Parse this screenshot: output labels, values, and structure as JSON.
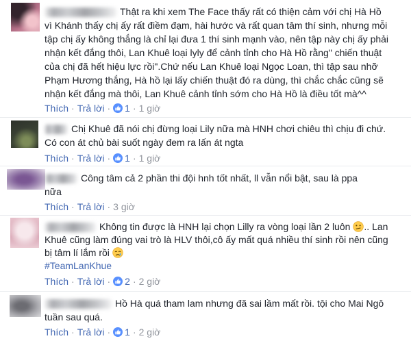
{
  "colors": {
    "text": "#1d2129",
    "link": "#4267b2",
    "meta": "#90949c",
    "reaction": "#5890ff",
    "divider": "#e9ebee"
  },
  "actions": {
    "like_label": "Thích",
    "reply_label": "Trả lời",
    "separator": "·",
    "reaction_icon": "like-reaction-icon"
  },
  "comments": [
    {
      "lines": [
        "Thật ra khi xem The Face thấy rất có thiện cảm với chị Hà Hồ",
        "vì Khánh thấy chị ấy rất điềm đạm, hài hước và rất quan tâm thí sinh, nhưng mỗi",
        "tập chị ấy không thắng là chỉ lại đưa 1 thí sinh mạnh vào, nên tập này chị ấy phải",
        "nhận kết đắng thôi, Lan Khuê loại lyly để cảnh tỉnh cho Hà Hồ rằng\" chiến thuật",
        "của chị đã hết hiệu lực rồi\".Chứ nếu Lan Khuê loại Ngọc Loan, thì tập sau nhỡ",
        "Phạm Hương thắng, Hà hồ lại lấy chiến thuật đó ra dùng, thì chắc chắc cũng sẽ",
        "nhận kết đắng mà thôi, Lan Khuê cảnh tỉnh sớm cho Hà Hồ là điều tốt mà^^"
      ],
      "reaction_count": "1",
      "time": "1 giờ"
    },
    {
      "lines": [
        "Chị Khuê đã nói chị đừng loại Lily nữa mà HNH chơi chiêu thì chịu đi chứ.",
        "Có con át chủ bài suốt ngày đem ra lấn át ngta"
      ],
      "reaction_count": "1",
      "time": "1 giờ"
    },
    {
      "lines": [
        "Công tâm cả 2 phần thi đội hnh tốt nhất, ll vẫn nổi bật, sau là ppa",
        "nữa"
      ],
      "time": "3 giờ"
    },
    {
      "lines": [
        [
          "Không tin được là HNH lại chọn Lilly ra vòng loại lần 2 luôn",
          ".. Lan"
        ],
        [
          "Khuê cũng làm đúng vai trò là HLV thôi,cô ấy mất quá nhiều thí sinh rồi nên cũng"
        ],
        [
          "bị tâm lí lắm rồi"
        ]
      ],
      "emojis": [
        "confused-face-icon",
        "crying-face-icon"
      ],
      "hashtag": "#TeamLanKhue",
      "reaction_count": "2",
      "time": "2 giờ"
    },
    {
      "lines": [
        "Hồ Hà quá tham lam nhưng đã sai lầm mất rồi. tội cho Mai Ngô",
        "tuần sau quá."
      ],
      "reaction_count": "1",
      "time": "2 giờ"
    }
  ]
}
